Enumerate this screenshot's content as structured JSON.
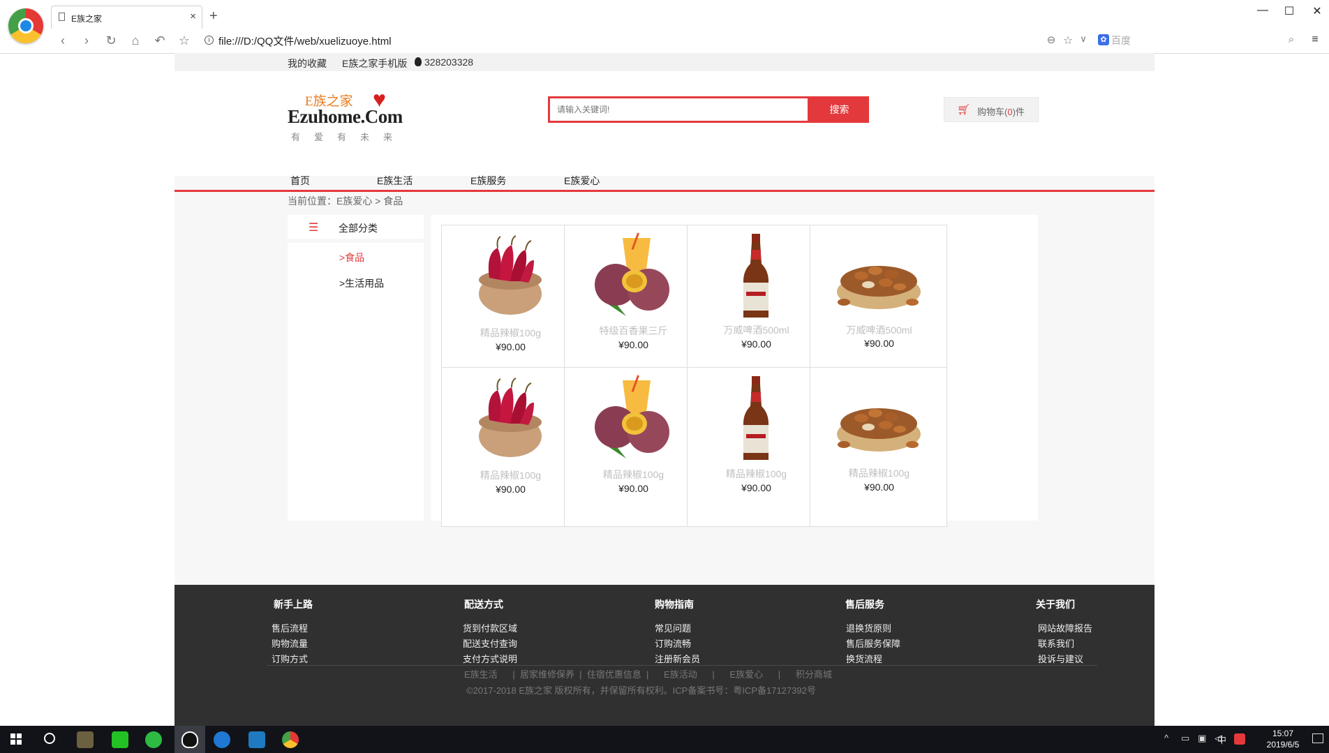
{
  "browser": {
    "tab_title": "E族之家",
    "url": "file:///D:/QQ文件/web/xuelizuoye.html",
    "search_engine": "百度",
    "window_buttons": [
      "—",
      "☐",
      "✕"
    ]
  },
  "topbar": {
    "favorites": "我的收藏",
    "mobile": "E族之家手机版",
    "qq": "328203328"
  },
  "logo": {
    "cn": "E族之家",
    "en": "Ezuhome.Com",
    "slogan": "有爱有未来"
  },
  "search": {
    "placeholder": "请输入关键词!",
    "button": "搜索"
  },
  "cart": {
    "prefix": "购物车(",
    "count": "0",
    "suffix": ")件"
  },
  "nav": [
    "首页",
    "E族生活",
    "E族服务",
    "E族爱心"
  ],
  "breadcrumb": "当前位置：E族爱心 > 食品",
  "sidebar": {
    "title": "全部分类",
    "items": [
      ">食品",
      ">生活用品"
    ]
  },
  "products": [
    {
      "name": "精品辣椒100g",
      "price": "¥90.00",
      "image": "chili-bowl"
    },
    {
      "name": "特级百香果三斤",
      "price": "¥90.00",
      "image": "passion-fruit"
    },
    {
      "name": "万威啤酒500ml",
      "price": "¥90.00",
      "image": "beer-bottle"
    },
    {
      "name": "万威啤酒500ml",
      "price": "¥90.00",
      "image": "nuts-bowl"
    },
    {
      "name": "精品辣椒100g",
      "price": "¥90.00",
      "image": "chili-bowl"
    },
    {
      "name": "精品辣椒100g",
      "price": "¥90.00",
      "image": "passion-fruit"
    },
    {
      "name": "精品辣椒100g",
      "price": "¥90.00",
      "image": "beer-bottle"
    },
    {
      "name": "精品辣椒100g",
      "price": "¥90.00",
      "image": "nuts-bowl"
    }
  ],
  "footer": {
    "columns": [
      {
        "title": "新手上路",
        "links": [
          "售后流程",
          "购物流量",
          "订购方式"
        ]
      },
      {
        "title": "配送方式",
        "links": [
          "货到付款区域",
          "配送支付查询",
          "支付方式说明"
        ]
      },
      {
        "title": "购物指南",
        "links": [
          "常见问题",
          "订购流畅",
          "注册新会员"
        ]
      },
      {
        "title": "售后服务",
        "links": [
          "退换货原则",
          "售后服务保障",
          "换货流程"
        ]
      },
      {
        "title": "关于我们",
        "links": [
          "网站故障报告",
          "联系我们",
          "投诉与建议"
        ]
      }
    ],
    "bottom_links": "E族生活      |  居家维修保养  |  住宿优惠信息  |      E族活动      |      E族爱心      |      积分商城",
    "copyright": "©2017-2018 E族之家 版权所有，并保留所有权利。ICP备案书号：粤ICP备17127392号"
  },
  "taskbar": {
    "time": "15:07",
    "date": "2019/6/5",
    "ime": "中"
  },
  "colors": {
    "accent": "#e4393c",
    "footer_bg": "#303030",
    "page_bg": "#f7f7f7"
  }
}
